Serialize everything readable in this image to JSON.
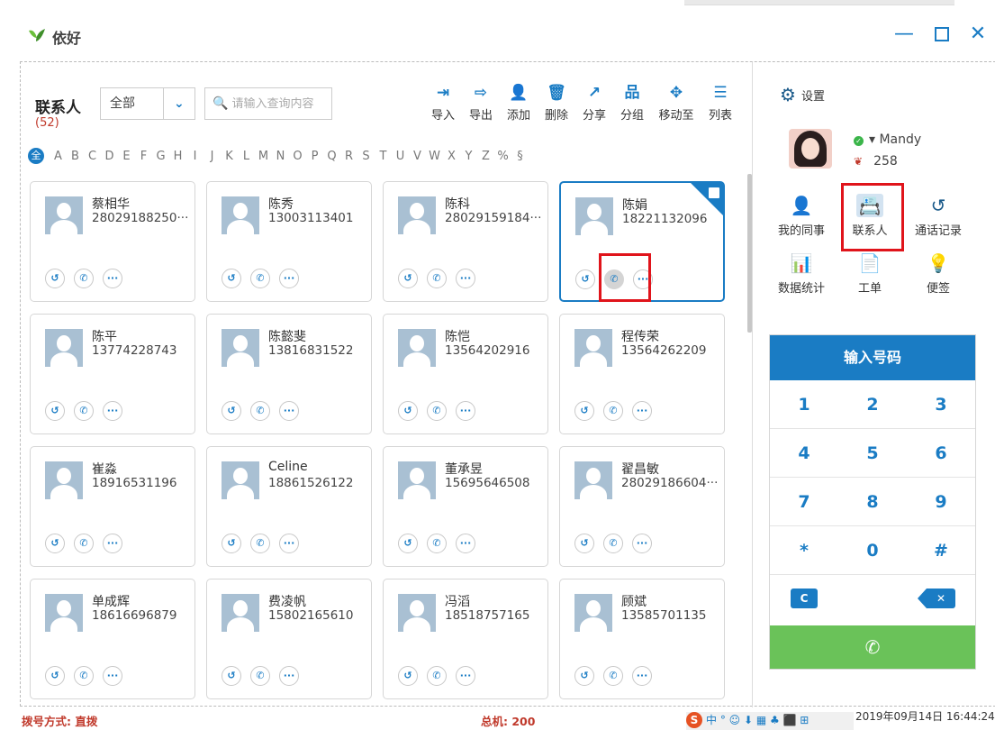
{
  "window": {
    "title": "依好",
    "min": "—",
    "close": "✕"
  },
  "contacts": {
    "title": "联系人",
    "count": "(52)",
    "filter_value": "全部",
    "search_placeholder": "请输入查询内容"
  },
  "toolbar": [
    {
      "icon": "import-icon",
      "glyph": "⇥",
      "label": "导入"
    },
    {
      "icon": "export-icon",
      "glyph": "⇨",
      "label": "导出"
    },
    {
      "icon": "add-user-icon",
      "glyph": "👤",
      "label": "添加"
    },
    {
      "icon": "trash-icon",
      "glyph": "🗑",
      "label": "删除"
    },
    {
      "icon": "share-icon",
      "glyph": "↗",
      "label": "分享"
    },
    {
      "icon": "group-icon",
      "glyph": "品",
      "label": "分组"
    },
    {
      "icon": "move-icon",
      "glyph": "✥",
      "label": "移动至"
    },
    {
      "icon": "list-icon",
      "glyph": "☰",
      "label": "列表"
    }
  ],
  "alphabet": [
    "A",
    "B",
    "C",
    "D",
    "E",
    "F",
    "G",
    "H",
    "I",
    "J",
    "K",
    "L",
    "M",
    "N",
    "O",
    "P",
    "Q",
    "R",
    "S",
    "T",
    "U",
    "V",
    "W",
    "X",
    "Y",
    "Z",
    "%",
    "§"
  ],
  "alphabet_all": "全",
  "cards": [
    {
      "name": "蔡相华",
      "phone": "28029188250···"
    },
    {
      "name": "陈秀",
      "phone": "13003113401"
    },
    {
      "name": "陈科",
      "phone": "28029159184···"
    },
    {
      "name": "陈娟",
      "phone": "18221132096",
      "selected": true
    },
    {
      "name": "陈平",
      "phone": "13774228743"
    },
    {
      "name": "陈懿斐",
      "phone": "13816831522"
    },
    {
      "name": "陈恺",
      "phone": "13564202916"
    },
    {
      "name": "程传荣",
      "phone": "13564262209"
    },
    {
      "name": "崔淼",
      "phone": "18916531196"
    },
    {
      "name": "Celine",
      "phone": "18861526122"
    },
    {
      "name": "董承昱",
      "phone": "15695646508"
    },
    {
      "name": "翟昌敏",
      "phone": "28029186604···"
    },
    {
      "name": "单成辉",
      "phone": "18616696879"
    },
    {
      "name": "费凌帆",
      "phone": "15802165610"
    },
    {
      "name": "冯滔",
      "phone": "18518757165"
    },
    {
      "name": "顾斌",
      "phone": "13585701135"
    }
  ],
  "card_actions": {
    "history": "↺",
    "call": "✆",
    "more": "···"
  },
  "sidebar": {
    "settings_label": "设置",
    "user_name": "▾ Mandy",
    "user_score": "258",
    "nav": [
      {
        "icon": "colleague-icon",
        "glyph": "👤",
        "label": "我的同事"
      },
      {
        "icon": "contacts-book-icon",
        "glyph": "📇",
        "label": "联系人",
        "active": true
      },
      {
        "icon": "call-history-icon",
        "glyph": "↺",
        "label": "通话记录"
      },
      {
        "icon": "stats-icon",
        "glyph": "📊",
        "label": "数据统计"
      },
      {
        "icon": "ticket-icon",
        "glyph": "📄",
        "label": "工单"
      },
      {
        "icon": "note-icon",
        "glyph": "💡",
        "label": "便签"
      }
    ]
  },
  "dialpad": {
    "title": "输入号码",
    "keys": [
      [
        "1",
        "2",
        "3"
      ],
      [
        "4",
        "5",
        "6"
      ],
      [
        "7",
        "8",
        "9"
      ],
      [
        "*",
        "0",
        "#"
      ]
    ],
    "clear": "C",
    "backspace": "✕",
    "call": "✆"
  },
  "statusbar": {
    "dial_mode": "拨号方式: 直拨",
    "total": "总机: 200",
    "ime": "中 ° ☺ ⬇ ▦ ♣ ⬛ ⊞",
    "time": "2019年09月14日 16:44:24"
  }
}
